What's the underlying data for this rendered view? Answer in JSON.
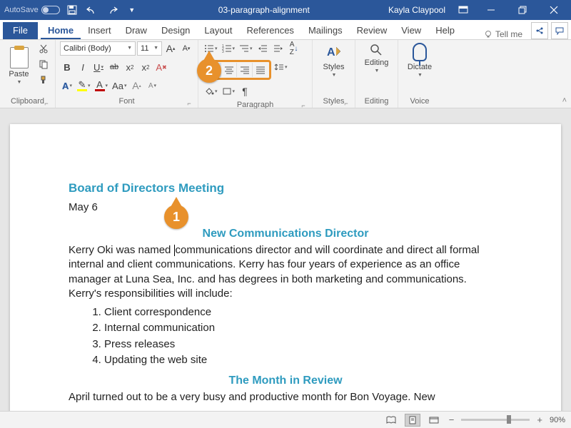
{
  "titlebar": {
    "autosave_label": "AutoSave",
    "autosave_state": "Off",
    "doc_title": "03-paragraph-alignment",
    "user": "Kayla Claypool"
  },
  "tabs": {
    "file": "File",
    "items": [
      "Home",
      "Insert",
      "Draw",
      "Design",
      "Layout",
      "References",
      "Mailings",
      "Review",
      "View",
      "Help"
    ],
    "active": "Home",
    "tellme": "Tell me"
  },
  "ribbon": {
    "clipboard": {
      "paste": "Paste",
      "label": "Clipboard"
    },
    "font": {
      "name": "Calibri (Body)",
      "size": "11",
      "label": "Font"
    },
    "paragraph": {
      "label": "Paragraph"
    },
    "styles": {
      "label": "Styles",
      "btn": "Styles"
    },
    "editing": {
      "label": "Editing",
      "btn": "Editing"
    },
    "voice": {
      "label": "Voice",
      "btn": "Dictate"
    }
  },
  "document": {
    "heading1": "Board of Directors Meeting",
    "date": "May 6",
    "heading2": "New Communications Director",
    "para1a": "Kerry Oki was named ",
    "para1b": "communications director and will coordinate and direct all formal internal and client communications. Kerry has four years of experience as an office manager at Luna Sea, Inc. and has degrees in both marketing and communications. Kerry's responsibilities will include:",
    "list": [
      "Client correspondence",
      "Internal communication",
      "Press releases",
      "Updating the web site"
    ],
    "heading3": "The Month in Review",
    "para2": "April turned out to be a very busy and productive month for Bon Voyage. New"
  },
  "callouts": {
    "one": "1",
    "two": "2"
  },
  "status": {
    "zoom": "90%"
  }
}
